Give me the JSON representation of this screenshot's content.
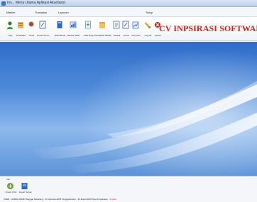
{
  "window": {
    "title": "Inv... Menu Utama Aplikasi Akuntansi"
  },
  "menu": [
    "Master",
    "Transaksi",
    "Laporan",
    "Tutup"
  ],
  "toolbar": [
    {
      "label": "User",
      "icon": "user-add-icon",
      "color": "#2f7e2f"
    },
    {
      "label": "Perkiraan",
      "icon": "chart-of-accounts-icon",
      "color": "#c9591b"
    },
    {
      "label": "Profil",
      "icon": "profile-icon",
      "color": "#2f7e2f"
    },
    {
      "label": "Jurnal Umum",
      "icon": "journal-icon",
      "color": "#2856b0"
    },
    {
      "label": "Buku Besar",
      "icon": "ledger-icon",
      "color": "#2f67c6"
    },
    {
      "label": "Neraca Saldo",
      "icon": "trial-balance-icon",
      "color": "#2f67c6"
    },
    {
      "label": "Laba Rugi",
      "icon": "profit-loss-icon",
      "color": "#5b7fb6"
    },
    {
      "label": "Perubahan Modal",
      "icon": "capital-change-icon",
      "color": "#e3a52b"
    },
    {
      "label": "Neraca",
      "icon": "balance-sheet-icon",
      "color": "#4b66a8"
    },
    {
      "label": "Jurnal",
      "icon": "journal-report-icon",
      "color": "#2856b0"
    },
    {
      "label": "Arus Kas",
      "icon": "cash-flow-icon",
      "color": "#2f67c6"
    },
    {
      "label": "Log Off",
      "icon": "logoff-icon",
      "color": "#e3a52b"
    },
    {
      "label": "Keluar",
      "icon": "exit-icon",
      "color": "#d61f12"
    }
  ],
  "brand": {
    "text": "CV INPSIRASI SOFTWARE",
    "color": "#d61f12"
  },
  "footer": {
    "section_label": "Info",
    "quick": [
      {
        "label": "Import COA",
        "icon": "import-coa-icon",
        "color": "#6aa531"
      },
      {
        "label": "Import Jurnal",
        "icon": "import-journal-icon",
        "color": "#2f67c6"
      }
    ],
    "status": "USER : ADMIN  ADMIN  Tanggal Sekarang : 27-Februari-2018  Tanggal Expire : 30-Maret-2018  Sisa Pemakaian :",
    "status_remaining": "31 Hari"
  }
}
